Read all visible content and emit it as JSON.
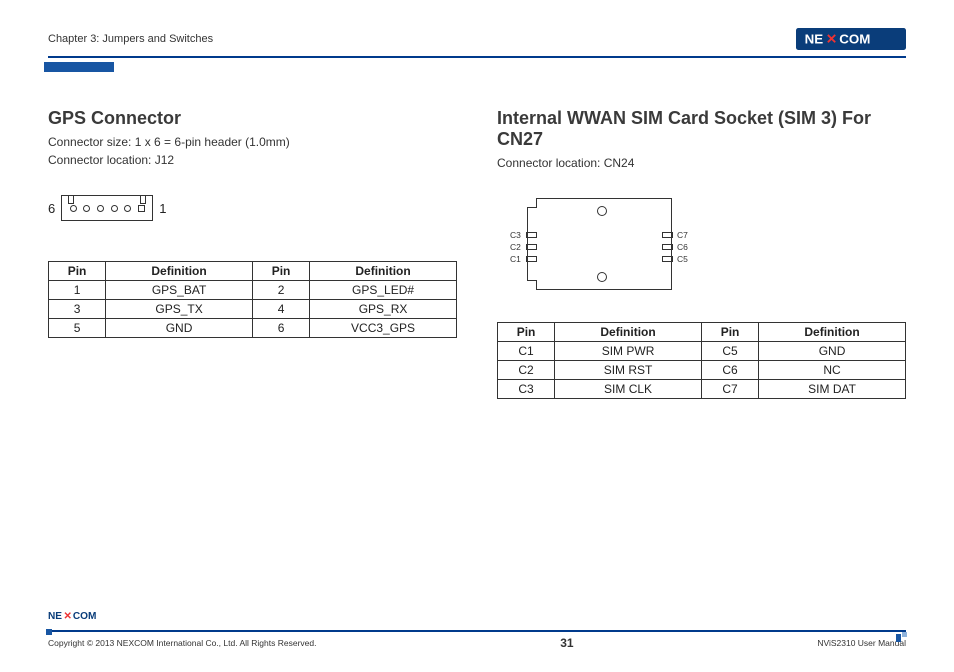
{
  "header": {
    "chapter": "Chapter 3: Jumpers and Switches",
    "logo_text": "NEXCOM"
  },
  "left": {
    "title": "GPS Connector",
    "size_line": "Connector size: 1 x 6 = 6-pin header (1.0mm)",
    "loc_line": "Connector location: J12",
    "diagram_left": "6",
    "diagram_right": "1",
    "table": {
      "headers": [
        "Pin",
        "Definition",
        "Pin",
        "Definition"
      ],
      "rows": [
        [
          "1",
          "GPS_BAT",
          "2",
          "GPS_LED#"
        ],
        [
          "3",
          "GPS_TX",
          "4",
          "GPS_RX"
        ],
        [
          "5",
          "GND",
          "6",
          "VCC3_GPS"
        ]
      ]
    }
  },
  "right": {
    "title": "Internal WWAN SIM Card Socket (SIM 3) For CN27",
    "loc_line": "Connector location: CN24",
    "pad_labels_left": [
      "C3",
      "C2",
      "C1"
    ],
    "pad_labels_right": [
      "C7",
      "C6",
      "C5"
    ],
    "table": {
      "headers": [
        "Pin",
        "Definition",
        "Pin",
        "Definition"
      ],
      "rows": [
        [
          "C1",
          "SIM PWR",
          "C5",
          "GND"
        ],
        [
          "C2",
          "SIM RST",
          "C6",
          "NC"
        ],
        [
          "C3",
          "SIM CLK",
          "C7",
          "SIM DAT"
        ]
      ]
    }
  },
  "footer": {
    "copyright": "Copyright © 2013 NEXCOM International Co., Ltd. All Rights Reserved.",
    "page": "31",
    "manual": "NViS2310 User Manual",
    "logo_text": "NEXCOM"
  }
}
